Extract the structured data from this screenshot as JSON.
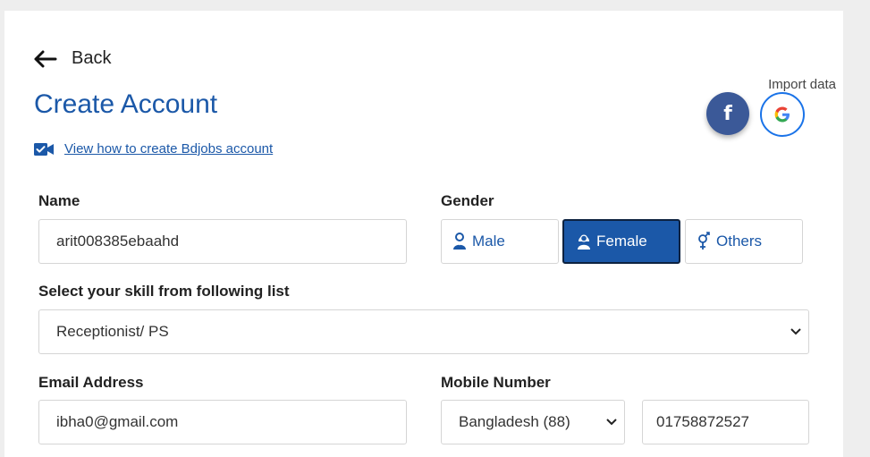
{
  "nav": {
    "back_label": "Back"
  },
  "header": {
    "title": "Create Account",
    "import_label": "Import data",
    "video_link": "View how to create Bdjobs account"
  },
  "form": {
    "name": {
      "label": "Name",
      "value": "arit008385ebaahd"
    },
    "gender": {
      "label": "Gender",
      "options": [
        {
          "label": "Male",
          "selected": false
        },
        {
          "label": "Female",
          "selected": true
        },
        {
          "label": "Others",
          "selected": false
        }
      ]
    },
    "skill": {
      "label": "Select your skill from following list",
      "value": "Receptionist/ PS"
    },
    "email": {
      "label": "Email Address",
      "value": "ibha0@gmail.com"
    },
    "mobile": {
      "label": "Mobile Number",
      "country": "Bangladesh (88)",
      "number": "01758872527"
    }
  },
  "colors": {
    "accent": "#1b58a8",
    "facebook": "#3b5998",
    "google_border": "#1a73e8"
  },
  "icons": [
    "back-arrow-icon",
    "facebook-icon",
    "google-icon",
    "video-icon",
    "male-icon",
    "female-icon",
    "others-gender-icon",
    "chevron-down-icon"
  ]
}
